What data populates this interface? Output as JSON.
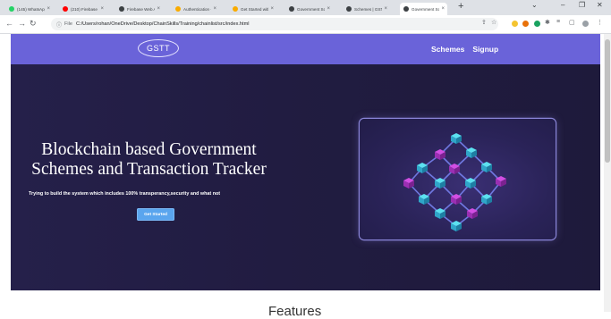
{
  "browser": {
    "tabs": [
      {
        "title": "(145) WhatsApp",
        "favicon_color": "#25d366"
      },
      {
        "title": "(210) Firebase W",
        "favicon_color": "#ff0000"
      },
      {
        "title": "Firebase Web Au",
        "favicon_color": "#3c4043"
      },
      {
        "title": "Authentication -",
        "favicon_color": "#f9ab00"
      },
      {
        "title": "Get Started with",
        "favicon_color": "#f9ab00"
      },
      {
        "title": "Government Sch",
        "favicon_color": "#3c4043"
      },
      {
        "title": "Schemes | GSTT",
        "favicon_color": "#3c4043"
      },
      {
        "title": "Government Sch",
        "favicon_color": "#3c4043",
        "active": true
      }
    ],
    "address_scheme": "File",
    "address_path": "C:/Users/rohan/OneDrive/Desktop/ChainSkills/Training/chainlist/src/index.html"
  },
  "nav": {
    "logo": "GSTT",
    "links": [
      "Schemes",
      "Signup"
    ]
  },
  "hero": {
    "title_line1": "Blockchain based Government",
    "title_line2": "Schemes and Transaction Tracker",
    "subtitle": "Trying to build the system which includes 100% transperancy,security and what not",
    "cta_label": "Get Started"
  },
  "features_heading": "Features",
  "colors": {
    "nav_bg": "#6a63d9",
    "hero_bg": "#221d42",
    "cta_bg": "#5aa5ee",
    "block_cyan": "#5ce1f0",
    "block_magenta": "#d24ee3"
  }
}
